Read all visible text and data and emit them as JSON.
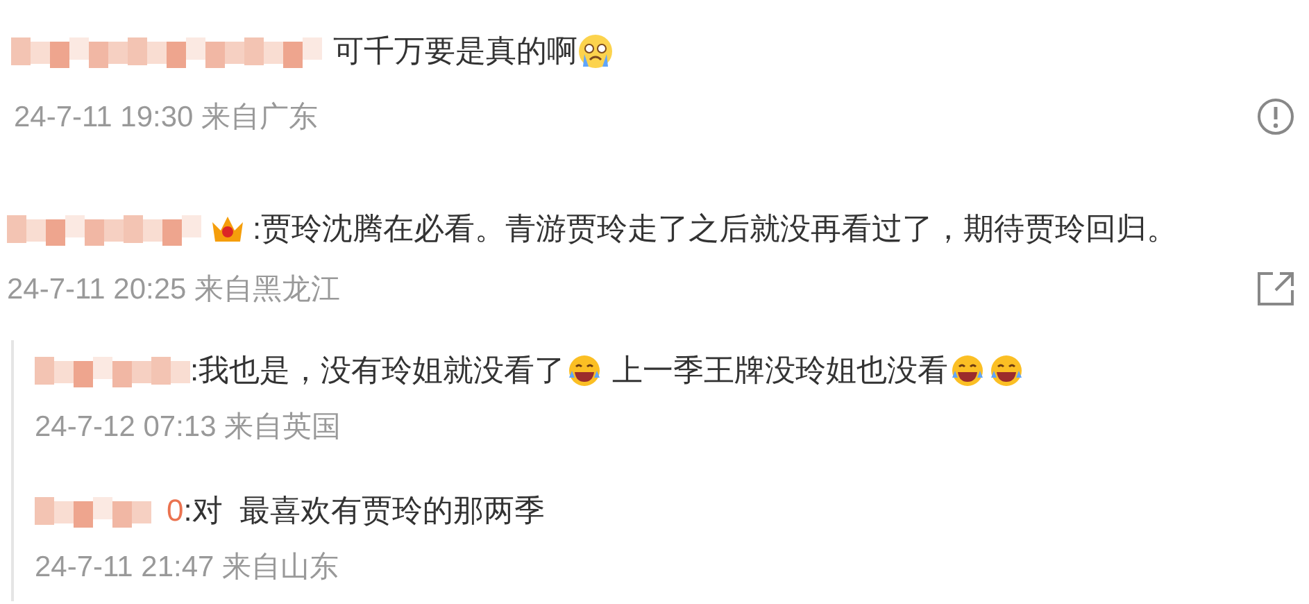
{
  "comments": [
    {
      "badge": false,
      "segments": [
        {
          "kind": "text",
          "text": "可千万要是真的啊"
        },
        {
          "kind": "crying-emoji"
        }
      ],
      "meta": "24-7-11 19:30 来自广东",
      "action": {
        "kind": "report"
      }
    },
    {
      "badge": true,
      "segments": [
        {
          "kind": "text",
          "text": ":贾玲沈腾在必看。青游贾玲走了之后就没再看过了，期待贾玲回归。"
        }
      ],
      "meta": "24-7-11 20:25 来自黑龙江",
      "action": {
        "kind": "share"
      },
      "replies": [
        {
          "segments": [
            {
              "kind": "text",
              "text": ":我也是，没有玲姐就没看了"
            },
            {
              "kind": "laughing-emoji"
            },
            {
              "kind": "text",
              "text": " 上一季王牌没玲姐也没看"
            },
            {
              "kind": "laughing-emoji"
            },
            {
              "kind": "laughing-emoji"
            }
          ],
          "meta": "24-7-12 07:13 来自英国"
        },
        {
          "name_visible": "0",
          "segments": [
            {
              "kind": "text",
              "text": ":对  最喜欢有贾玲的那两季"
            }
          ],
          "meta": "24-7-11 21:47 来自山东"
        }
      ]
    }
  ]
}
